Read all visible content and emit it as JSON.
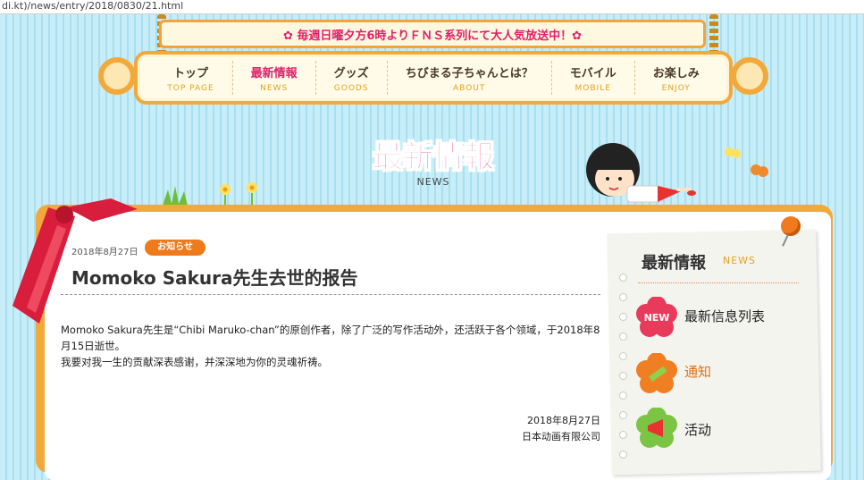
{
  "browser": {
    "url_text": "di.kt)/news/entry/2018/0830/21.html"
  },
  "banner": {
    "text": "✿ 毎週日曜夕方6時よりＦＮＳ系列にて大人気放送中！✿"
  },
  "nav": {
    "items": [
      {
        "jp": "トップ",
        "en": "TOP PAGE",
        "active": false
      },
      {
        "jp": "最新情報",
        "en": "NEWS",
        "active": true
      },
      {
        "jp": "グッズ",
        "en": "GOODS",
        "active": false
      },
      {
        "jp": "ちびまる子ちゃんとは？",
        "en": "ABOUT",
        "active": false
      },
      {
        "jp": "モバイル",
        "en": "MOBILE",
        "active": false
      },
      {
        "jp": "お楽しみ",
        "en": "ENJOY",
        "active": false
      }
    ]
  },
  "page": {
    "title": "最新情報",
    "subtitle": "NEWS"
  },
  "article": {
    "date": "2018年8月27日",
    "tag": "お知らせ",
    "title": "Momoko Sakura先生去世的报告",
    "body1": "Momoko Sakura先生是“Chibi Maruko-chan”的原创作者，除了广泛的写作活动外，还活跃于各个领域，于2018年8月15日逝世。",
    "body2": "我要对我一生的贡献深表感谢，并深深地为你的灵魂祈祷。",
    "sign_date": "2018年8月27日",
    "sign_company": "日本动画有限公司"
  },
  "sidebar": {
    "title": "最新情報",
    "subtitle": "NEWS",
    "items": [
      {
        "label": "最新信息列表",
        "badge": "NEW",
        "icon": "new-flower-icon",
        "highlight": false
      },
      {
        "label": "通知",
        "badge": "",
        "icon": "pencil-flower-icon",
        "highlight": true
      },
      {
        "label": "活动",
        "badge": "",
        "icon": "megaphone-flower-icon",
        "highlight": false
      }
    ]
  },
  "colors": {
    "accent": "#f2a93b",
    "title_pink": "#e43a75",
    "tag_orange": "#ef7a1b",
    "sky": "#bfe9f5"
  }
}
